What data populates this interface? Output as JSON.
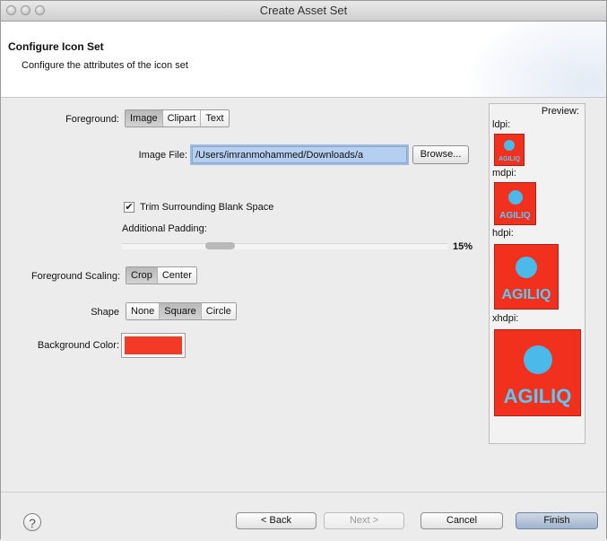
{
  "window": {
    "title": "Create Asset Set"
  },
  "banner": {
    "heading": "Configure Icon Set",
    "description": "Configure the attributes of the icon set"
  },
  "foreground": {
    "label": "Foreground:",
    "options": [
      "Image",
      "Clipart",
      "Text"
    ],
    "selected": "Image"
  },
  "image_file": {
    "label": "Image File:",
    "value": "/Users/imranmohammed/Downloads/a",
    "browse_label": "Browse..."
  },
  "trim": {
    "label": "Trim Surrounding Blank Space",
    "checked": true,
    "check_glyph": "✔"
  },
  "padding": {
    "label": "Additional Padding:",
    "value_text": "15%",
    "value": 15
  },
  "scaling": {
    "label": "Foreground Scaling:",
    "options": [
      "Crop",
      "Center"
    ],
    "selected": "Crop"
  },
  "shape": {
    "label": "Shape",
    "options": [
      "None",
      "Square",
      "Circle"
    ],
    "selected": "Square"
  },
  "background": {
    "label": "Background Color:",
    "color": "#f33a26"
  },
  "preview": {
    "title": "Preview:",
    "items": [
      {
        "label": "ldpi:",
        "text": "AGILIQ"
      },
      {
        "label": "mdpi:",
        "text": "AGILIQ"
      },
      {
        "label": "hdpi:",
        "text": "AGILIQ"
      },
      {
        "label": "xhdpi:",
        "text": "AGILIQ"
      }
    ]
  },
  "footer": {
    "help_glyph": "?",
    "back": "< Back",
    "next": "Next >",
    "cancel": "Cancel",
    "finish": "Finish"
  }
}
